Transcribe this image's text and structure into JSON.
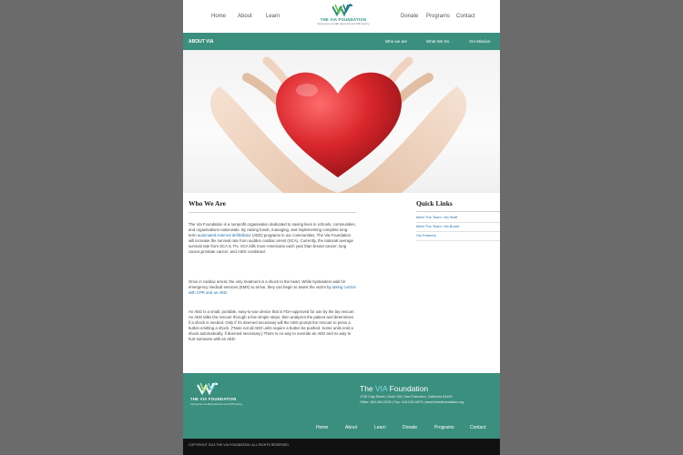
{
  "header": {
    "nav_left": [
      "Home",
      "About",
      "Learn"
    ],
    "nav_right": [
      "Donate",
      "Programs",
      "Contact"
    ],
    "logo_name": "THE VIA FOUNDATION",
    "logo_tagline": "Saving lives via AED placement and CPR training"
  },
  "subnav": {
    "title": "ABOUT VIA",
    "links": [
      "Who we are",
      "What We Do",
      "VIA Mission"
    ]
  },
  "main": {
    "heading": "Who We Are",
    "p1_a": "The Via Foundation is a nonprofit organisation dedicated to saving lives in schools, communities, and organisations nationwide. By raising funds, managing, and implementing complete long-term ",
    "p1_link": "automated external defibrillator",
    "p1_b": " (AED) programs in our communities, The Via Foundation will increase the survival rate from sudden cardiac arrest (SCA). Currently, the national average survival rate from SCA is 7%. SCA kills more Americans each year than breast cancer, lung cancer,prostate cancer, and AIDS combined.",
    "p2_a": "Once in cardiac arrest, the only treatment is a shock to the heart. While bystanders wait for emergency medical services (EMS) to arrive, they can begin to assist the victim by ",
    "p2_link": "taking control with CPR and an AED",
    "p2_b": ".",
    "p3": "An AED is a small, portable, easy-to-use device that is FDA-approved for use by the lay rescuer. An AED talks the rescuer through a few simple steps, then analyzes the patient and determines if a shock is needed. Only if it's deemed necessary will the AED prompt the rescuer to press a button emitting a shock. (*Note not all AED units require a button be pushed. Some units emit a shock automatically, if deemed necessary.) There is no way to override an AED and no way to hurt someone with an AED."
  },
  "quick_links": {
    "heading": "Quick Links",
    "items": [
      "Meet The Team: Via Staff",
      "Meet The Team: Via Board",
      "Via Partners"
    ]
  },
  "footer": {
    "title_a": "The ",
    "title_via": "VIA",
    "title_b": " Foundation",
    "address": "1725 Clay Street  |  Suite 100  |  San Francisco, California 94109",
    "contact": "Office: 800-284-0125  |  Fax: 415-226-0675  |  www.theviafoundation.org",
    "logo_name": "THE VIA FOUNDATION",
    "logo_tagline": "Saving lives via AED placement and CPR training",
    "nav": [
      "Home",
      "About",
      "Learn",
      "Donate",
      "Programs",
      "Contact"
    ],
    "copyright": "COPYRIGHT 2013 THE VIA FOUNDATION. ALL RIGHTS RESERVED."
  },
  "colors": {
    "background": "#6b6b6b",
    "brand_teal": "#3b8f7e",
    "link_blue": "#2a73a8",
    "heart_red": "#d8262c"
  }
}
